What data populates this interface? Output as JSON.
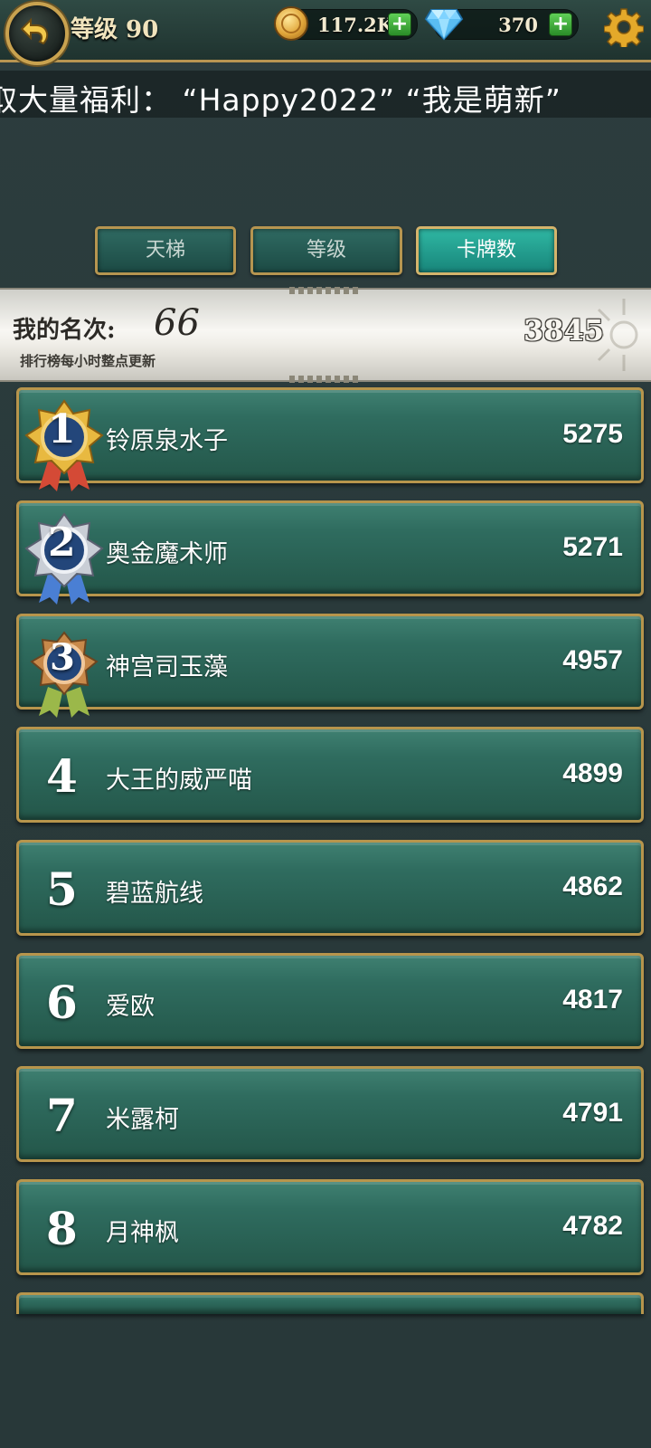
{
  "header": {
    "level_label": "等级 90",
    "coins": "117.2K",
    "gems": "370",
    "plus": "+"
  },
  "marquee": {
    "text": "取大量福利：  “Happy2022”   “我是萌新”"
  },
  "tabs": [
    {
      "label": "天梯",
      "active": false
    },
    {
      "label": "等级",
      "active": false
    },
    {
      "label": "卡牌数",
      "active": true
    }
  ],
  "my_rank": {
    "label": "我的名次:",
    "rank": "66",
    "note": "排行榜每小时整点更新",
    "score": "3845"
  },
  "leaderboard": [
    {
      "rank": "1",
      "name": "铃原泉水子",
      "score": "5275"
    },
    {
      "rank": "2",
      "name": "奥金魔术师",
      "score": "5271"
    },
    {
      "rank": "3",
      "name": "神宫司玉藻",
      "score": "4957"
    },
    {
      "rank": "4",
      "name": "大王的威严喵",
      "score": "4899"
    },
    {
      "rank": "5",
      "name": "碧蓝航线",
      "score": "4862"
    },
    {
      "rank": "6",
      "name": "爱欧",
      "score": "4817"
    },
    {
      "rank": "7",
      "name": "米露柯",
      "score": "4791"
    },
    {
      "rank": "8",
      "name": "月神枫",
      "score": "4782"
    }
  ],
  "colors": {
    "gold_border": "#b7954c",
    "row_green": "#2f6c5f",
    "active_tab": "#2fb7a3",
    "medal_gold": "#e8b940",
    "medal_silver": "#c9ced6",
    "medal_bronze": "#c8894a"
  }
}
